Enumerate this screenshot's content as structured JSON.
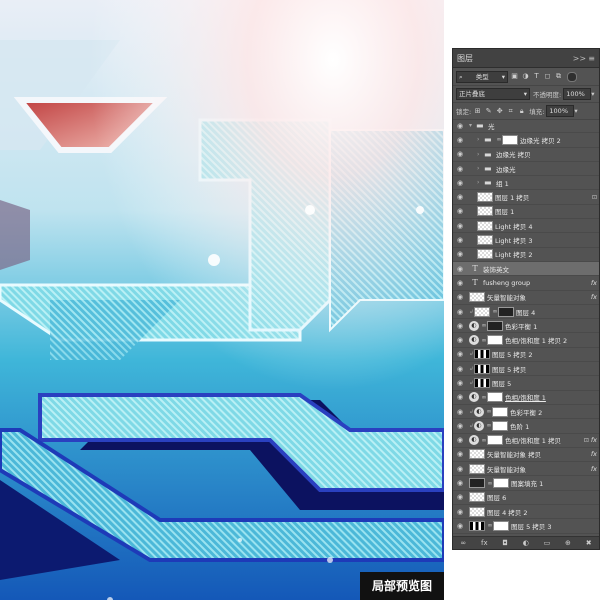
{
  "preview_label": "局部预览图",
  "panel": {
    "title": "图层",
    "collapse_icon": ">>",
    "menu_icon": "≡",
    "filter_kind": "类型",
    "blend_mode": "正片叠底",
    "opacity_label": "不透明度:",
    "opacity_value": "100%",
    "lock_label": "锁定:",
    "fill_label": "填充:",
    "fill_value": "100%"
  },
  "layers": [
    {
      "name": "光",
      "kind": "group",
      "indent": 0,
      "open": true
    },
    {
      "name": "边缘光 拷贝 2",
      "kind": "group",
      "indent": 1,
      "mask": true
    },
    {
      "name": "边缘光 拷贝",
      "kind": "group",
      "indent": 1
    },
    {
      "name": "边缘光",
      "kind": "group",
      "indent": 1
    },
    {
      "name": "组 1",
      "kind": "group",
      "indent": 1
    },
    {
      "name": "图层 1 拷贝",
      "kind": "pixel",
      "indent": 1,
      "lock": true
    },
    {
      "name": "图层 1",
      "kind": "pixel",
      "indent": 1
    },
    {
      "name": "Light 拷贝 4",
      "kind": "pixel",
      "indent": 1
    },
    {
      "name": "Light 拷贝 3",
      "kind": "pixel",
      "indent": 1
    },
    {
      "name": "Light 拷贝 2",
      "kind": "pixel",
      "indent": 1
    },
    {
      "name": "装饰英文",
      "kind": "text",
      "indent": 0,
      "selected": true
    },
    {
      "name": "fusheng group",
      "kind": "text",
      "indent": 0,
      "fx": true
    },
    {
      "name": "矢量智能对象",
      "kind": "smart",
      "indent": 0,
      "fx": true
    },
    {
      "name": "图层 4",
      "kind": "pixel",
      "indent": 0,
      "clip": true,
      "mask": true,
      "darkmask": true
    },
    {
      "name": "色彩平衡 1",
      "kind": "adjust",
      "indent": 0,
      "mask": true,
      "darkmask": true
    },
    {
      "name": "色相/饱和度 1 拷贝 2",
      "kind": "adjust",
      "indent": 0,
      "mask": true
    },
    {
      "name": "图层 5 拷贝 2",
      "kind": "pixel",
      "indent": 0,
      "clip": true,
      "bars": true
    },
    {
      "name": "图层 5 拷贝",
      "kind": "pixel",
      "indent": 0,
      "clip": true,
      "bars": true
    },
    {
      "name": "图层 5",
      "kind": "pixel",
      "indent": 0,
      "clip": true,
      "bars": true
    },
    {
      "name": "色相/饱和度 1",
      "kind": "adjust",
      "indent": 0,
      "mask": true,
      "strike": true
    },
    {
      "name": "色彩平衡 2",
      "kind": "adjust",
      "indent": 0,
      "clip": true,
      "mask": true
    },
    {
      "name": "色阶 1",
      "kind": "adjust",
      "indent": 0,
      "clip": true,
      "mask": true
    },
    {
      "name": "色相/饱和度 1 拷贝",
      "kind": "adjust",
      "indent": 0,
      "mask": true,
      "lock": true,
      "fx": true
    },
    {
      "name": "矢量智能对象 拷贝",
      "kind": "smart",
      "indent": 0,
      "fx": true
    },
    {
      "name": "矢量智能对象",
      "kind": "smart",
      "indent": 0,
      "fx": true
    },
    {
      "name": "图案填充 1",
      "kind": "adjust",
      "indent": 0,
      "darkthumb": true,
      "mask": true
    },
    {
      "name": "图层 6",
      "kind": "pixel",
      "indent": 0
    },
    {
      "name": "图层 4 拷贝 2",
      "kind": "pixel",
      "indent": 0
    },
    {
      "name": "图层 5 拷贝 3",
      "kind": "pixel",
      "indent": 0,
      "bars": true,
      "mask": true
    }
  ],
  "footer_icons": [
    "link-icon",
    "fx-icon",
    "mask-icon",
    "adjustment-icon",
    "folder-icon",
    "new-layer-icon",
    "trash-icon"
  ],
  "colors": {
    "panel_bg": "#535353",
    "selected_row": "#6d6d6d",
    "art_cyan": "#5fd0e0",
    "art_blue": "#1a2a8a"
  }
}
